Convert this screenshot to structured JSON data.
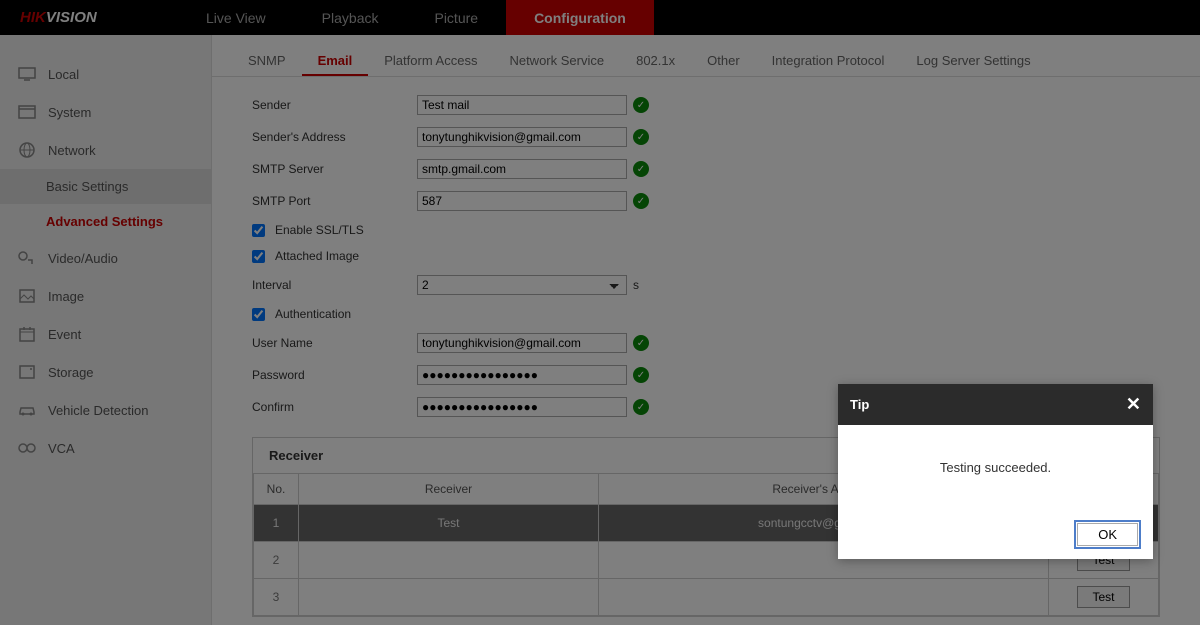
{
  "logo": {
    "hik": "HIK",
    "vision": "VISION"
  },
  "topnav": [
    "Live View",
    "Playback",
    "Picture",
    "Configuration"
  ],
  "topnav_active": 3,
  "sidebar": [
    {
      "label": "Local",
      "icon": "monitor"
    },
    {
      "label": "System",
      "icon": "window"
    },
    {
      "label": "Network",
      "icon": "globe",
      "children": [
        {
          "label": "Basic Settings"
        },
        {
          "label": "Advanced Settings",
          "active": true
        }
      ]
    },
    {
      "label": "Video/Audio",
      "icon": "av"
    },
    {
      "label": "Image",
      "icon": "image"
    },
    {
      "label": "Event",
      "icon": "calendar"
    },
    {
      "label": "Storage",
      "icon": "storage"
    },
    {
      "label": "Vehicle Detection",
      "icon": "car"
    },
    {
      "label": "VCA",
      "icon": "vca"
    }
  ],
  "tabs": [
    "SNMP",
    "Email",
    "Platform Access",
    "Network Service",
    "802.1x",
    "Other",
    "Integration Protocol",
    "Log Server Settings"
  ],
  "tabs_active": 1,
  "form": {
    "sender_label": "Sender",
    "sender": "Test mail",
    "sender_addr_label": "Sender's Address",
    "sender_addr": "tonytunghikvision@gmail.com",
    "smtp_server_label": "SMTP Server",
    "smtp_server": "smtp.gmail.com",
    "smtp_port_label": "SMTP Port",
    "smtp_port": "587",
    "enable_ssl_label": "Enable SSL/TLS",
    "enable_ssl": true,
    "attached_image_label": "Attached Image",
    "attached_image": true,
    "interval_label": "Interval",
    "interval": "2",
    "interval_unit": "s",
    "authentication_label": "Authentication",
    "authentication": true,
    "username_label": "User Name",
    "username": "tonytunghikvision@gmail.com",
    "password_label": "Password",
    "password": "●●●●●●●●●●●●●●●●",
    "confirm_label": "Confirm",
    "confirm": "●●●●●●●●●●●●●●●●"
  },
  "receiver": {
    "title": "Receiver",
    "headers": {
      "no": "No.",
      "receiver": "Receiver",
      "address": "Receiver's Address",
      "test": "Test"
    },
    "rows": [
      {
        "no": "1",
        "receiver": "Test",
        "address": "sontungcctv@gmail.com"
      },
      {
        "no": "2",
        "receiver": "",
        "address": ""
      },
      {
        "no": "3",
        "receiver": "",
        "address": ""
      }
    ],
    "test_btn": "Test"
  },
  "dialog": {
    "title": "Tip",
    "message": "Testing succeeded.",
    "ok": "OK"
  }
}
